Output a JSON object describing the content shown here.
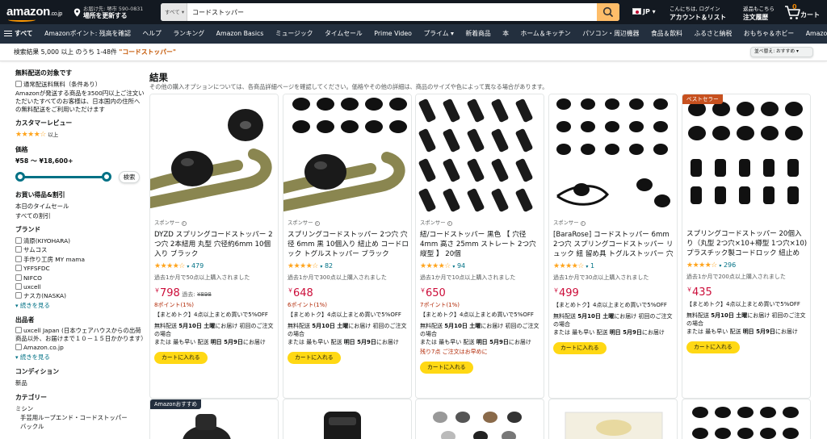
{
  "header": {
    "logo_main": "amazon",
    "logo_tld": ".co.jp",
    "location_line1": "お届け先: 堺市 590-0831",
    "location_line2": "場所を更新する",
    "search_category": "すべて",
    "search_value": "コードストッパー",
    "language": "JP",
    "account_line1": "こんにちは, ログイン",
    "account_line2": "アカウント＆リスト",
    "orders_line1": "返品もこちら",
    "orders_line2": "注文履歴",
    "cart_count": "0",
    "cart_label": "カート"
  },
  "nav": {
    "all_label": "すべて",
    "items": [
      "Amazonポイント: 残高を確認",
      "ヘルプ",
      "ランキング",
      "Amazon Basics",
      "ミュージック",
      "タイムセール",
      "Prime Video",
      "プライム",
      "新着商品",
      "本",
      "ホーム＆キッチン",
      "パソコン・周辺機器",
      "食品＆飲料",
      "ふるさと納税",
      "おもちゃ＆ホビー",
      "Amazonファッション"
    ]
  },
  "results_bar": {
    "count_text": "検索結果 5,000 以上 のうち 1-48件",
    "query": "\"コードストッパー\"",
    "sort_label": "並べ替え: おすすめ"
  },
  "sidebar": {
    "free_ship_heading": "無料配送の対象です",
    "free_ship_option": "通常配送料無料（条件あり）",
    "free_ship_note": "Amazonが発送する商品を3500円以上ご注文いただいたすべてのお客様は、日本国内の住所への無料配送をご利用いただけます",
    "review_heading": "カスタマーレビュー",
    "review_stars": "★★★★☆",
    "review_suffix": "以上",
    "price_heading": "価格",
    "price_range": "¥58 ～ ¥18,600+",
    "go_label": "検索",
    "deals_heading": "お買い得品&割引",
    "deals": [
      "本日のタイムセール",
      "すべての割引"
    ],
    "brand_heading": "ブランド",
    "brands": [
      "清原(KIYOHARA)",
      "サムコス",
      "手作り工房 MY mama",
      "YFFSFDC",
      "NIFCO",
      "uxcell",
      "ナスカ(NASKA)"
    ],
    "see_more": "続きを見る",
    "seller_heading": "出品者",
    "sellers": [
      "uxcell Japan (日本ウェアハウスからの出荷商品以外、お届けまで１０－１５日かかります）",
      "Amazon.co.jp"
    ],
    "see_more2": "続きを見る",
    "condition_heading": "コンディション",
    "condition": "新品",
    "category_heading": "カテゴリー",
    "category1": "ミシン",
    "category2": "手芸用ループエンド・コードストッパー",
    "category3": "バックル"
  },
  "main": {
    "title": "結果",
    "subtitle": "その他の購入オプションについては、各商品詳細ページを確認してください。価格やその他の詳細は、商品のサイズや色によって異なる場合があります。"
  },
  "products": [
    {
      "sponsored": "スポンサー",
      "title": "DYZD スプリングコードストッパー 2つ穴 2本紐用 丸型 穴径約6mm 10個入り ブラック",
      "stars": "★★★★☆",
      "reviews": "479",
      "bought": "過去1か月で50点以上購入されました",
      "price": "798",
      "was_label": "過去:",
      "was_price": "¥898",
      "points": "8ポイント(1%)",
      "promo": "【まとめトク】4点以上まとめ買いで5%OFF",
      "ship_prefix": "無料配送",
      "ship_date": "5月10日 土曜",
      "ship_suffix": "にお届け 初回のご注文の場合",
      "fast_prefix": "または 最も早い 配送",
      "fast_date": "明日 5月9日",
      "fast_suffix": "にお届け",
      "stock": "",
      "cart": "カートに入れる"
    },
    {
      "sponsored": "スポンサー",
      "title": "スプリングコードストッパー 2つ穴 穴径 6mm 黒 10個入り 紐止め コードロック トグルストッパー ブラック",
      "stars": "★★★★☆",
      "reviews": "82",
      "bought": "過去1か月で300点以上購入されました",
      "price": "648",
      "was_label": "",
      "was_price": "",
      "points": "6ポイント(1%)",
      "promo": "【まとめトク】4点以上まとめ買いで5%OFF",
      "ship_prefix": "無料配送",
      "ship_date": "5月10日 土曜",
      "ship_suffix": "にお届け 初回のご注文の場合",
      "fast_prefix": "または 最も早い 配送",
      "fast_date": "明日 5月9日",
      "fast_suffix": "にお届け",
      "stock": "",
      "cart": "カートに入れる"
    },
    {
      "sponsored": "スポンサー",
      "title": "紐/コードストッパー 黒色 【 穴径 4mm 高さ 25mm ストレート 2つ穴 縦型 】 20個",
      "stars": "★★★★☆",
      "reviews": "94",
      "bought": "過去1か月で10点以上購入されました",
      "price": "650",
      "was_label": "",
      "was_price": "",
      "points": "7ポイント(1%)",
      "promo": "【まとめトク】4点以上まとめ買いで5%OFF",
      "ship_prefix": "無料配送",
      "ship_date": "5月10日 土曜",
      "ship_suffix": "にお届け 初回のご注文の場合",
      "fast_prefix": "または 最も早い 配送",
      "fast_date": "明日 5月9日",
      "fast_suffix": "にお届け",
      "stock": "残り7点 ご注文はお早めに",
      "cart": "カートに入れる"
    },
    {
      "sponsored": "スポンサー",
      "title": "[BaraRose] コードストッパー 6mm 2つ穴 スプリングコードストッパー リュック 紐 留め具 トグルストッパー 穴径約6mm 多用途 紐用ゴム スプ…",
      "stars": "★★★★☆",
      "reviews": "1",
      "bought": "過去1か月で30点以上購入されました",
      "price": "499",
      "was_label": "",
      "was_price": "",
      "points": "",
      "promo": "【まとめトク】4点以上まとめ買いで5%OFF",
      "ship_prefix": "無料配送",
      "ship_date": "5月10日 土曜",
      "ship_suffix": "にお届け 初回のご注文の場合",
      "fast_prefix": "または 最も早い 配送",
      "fast_date": "明日 5月9日",
      "fast_suffix": "にお届け",
      "stock": "",
      "cart": "カートに入れる"
    },
    {
      "sponsored": "",
      "badge": "ベストセラー",
      "title": "スプリングコードストッパー 20個入り（丸型 2つ穴×10+樽型 1つ穴×10) プラスチック製コードロック 紐止め 穴径約6mm 交換 補修用 靴ひもに…",
      "stars": "★★★★☆",
      "reviews": "296",
      "bought": "過去1か月で200点以上購入されました",
      "price": "435",
      "was_label": "",
      "was_price": "",
      "points": "",
      "promo": "【まとめトク】4点以上まとめ買いで5%OFF",
      "ship_prefix": "無料配送",
      "ship_date": "5月10日 土曜",
      "ship_suffix": "にお届け 初回のご注文の場合",
      "fast_prefix": "または 最も早い 配送",
      "fast_date": "明日 5月9日",
      "fast_suffix": "にお届け",
      "stock": "",
      "cart": "カートに入れる"
    }
  ],
  "bottom_badge": "Amazonおすすめ",
  "colors": {
    "header_bg": "#131921",
    "nav_bg": "#232f3e",
    "search_button": "#febd69",
    "price_red": "#cc0c39",
    "link_teal": "#007185",
    "cart_yellow": "#ffd814",
    "bestseller": "#cc0c39",
    "star_orange": "#ffa41c"
  }
}
